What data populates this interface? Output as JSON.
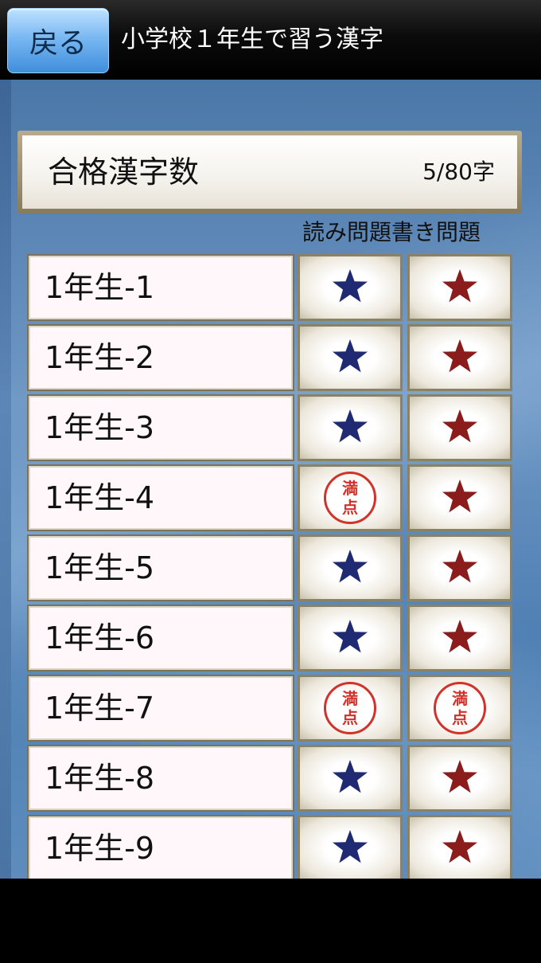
{
  "header": {
    "back_label": "戻る",
    "title": "小学校１年生で習う漢字"
  },
  "score": {
    "label": "合格漢字数",
    "count": "5/80字"
  },
  "columns": {
    "reading": "読み問題",
    "writing": "書き問題"
  },
  "colors": {
    "reading_star": "#1f2a72",
    "writing_star": "#8a1c1c",
    "stamp": "#d0332b"
  },
  "stamp_text": [
    "満",
    "点"
  ],
  "rows": [
    {
      "label": "1年生-1",
      "reading": "star-icon",
      "writing": "star-icon"
    },
    {
      "label": "1年生-2",
      "reading": "star-icon",
      "writing": "star-icon"
    },
    {
      "label": "1年生-3",
      "reading": "star-icon",
      "writing": "star-icon"
    },
    {
      "label": "1年生-4",
      "reading": "perfect-stamp-icon",
      "writing": "star-icon"
    },
    {
      "label": "1年生-5",
      "reading": "star-icon",
      "writing": "star-icon"
    },
    {
      "label": "1年生-6",
      "reading": "star-icon",
      "writing": "star-icon"
    },
    {
      "label": "1年生-7",
      "reading": "perfect-stamp-icon",
      "writing": "perfect-stamp-icon"
    },
    {
      "label": "1年生-8",
      "reading": "star-icon",
      "writing": "star-icon"
    },
    {
      "label": "1年生-9",
      "reading": "star-icon",
      "writing": "star-icon"
    }
  ]
}
